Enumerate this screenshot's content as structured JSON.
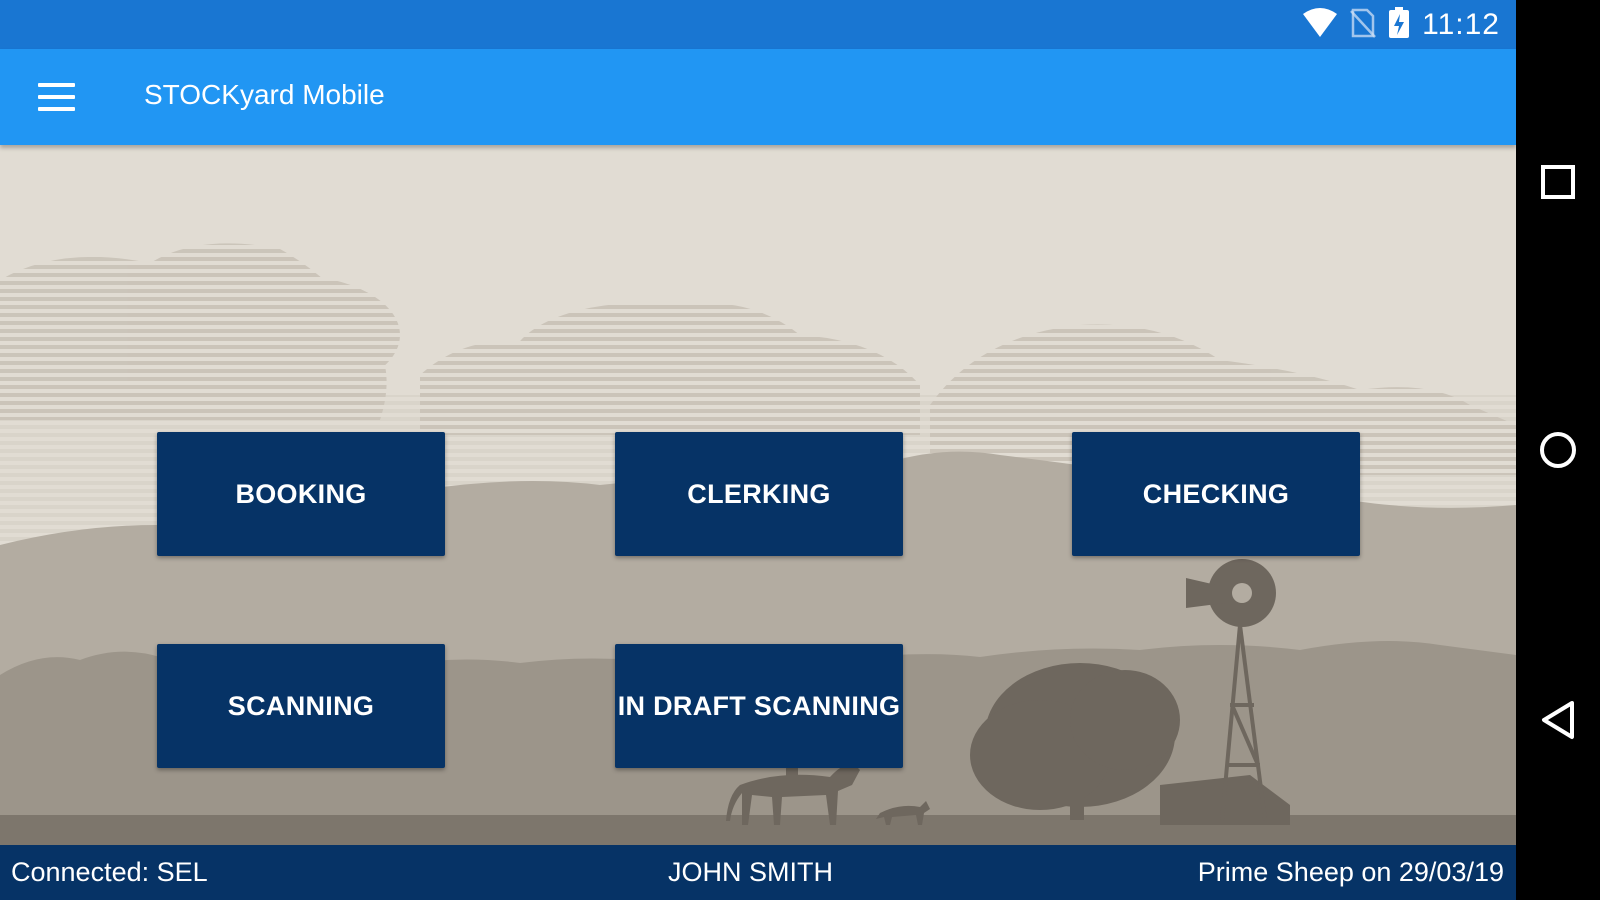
{
  "status_bar": {
    "time": "11:12",
    "icons": [
      "wifi-icon",
      "no-sim-icon",
      "battery-charging-icon"
    ]
  },
  "app_bar": {
    "title": "STOCKyard Mobile",
    "menu_icon": "hamburger-menu-icon"
  },
  "tiles": [
    {
      "label": "BOOKING"
    },
    {
      "label": "CLERKING"
    },
    {
      "label": "CHECKING"
    },
    {
      "label": "SCANNING"
    },
    {
      "label": "IN DRAFT SCANNING"
    }
  ],
  "footer": {
    "connection": "Connected: SEL",
    "user": "JOHN SMITH",
    "sale": "Prime Sheep on 29/03/19"
  },
  "nav_bar": {
    "buttons": [
      "recents-icon",
      "home-icon",
      "back-icon"
    ]
  },
  "colors": {
    "status_bar": "#1976d2",
    "app_bar": "#2196f3",
    "tile": "#063366",
    "footer": "#063366",
    "sky": "#e1dcd3"
  }
}
